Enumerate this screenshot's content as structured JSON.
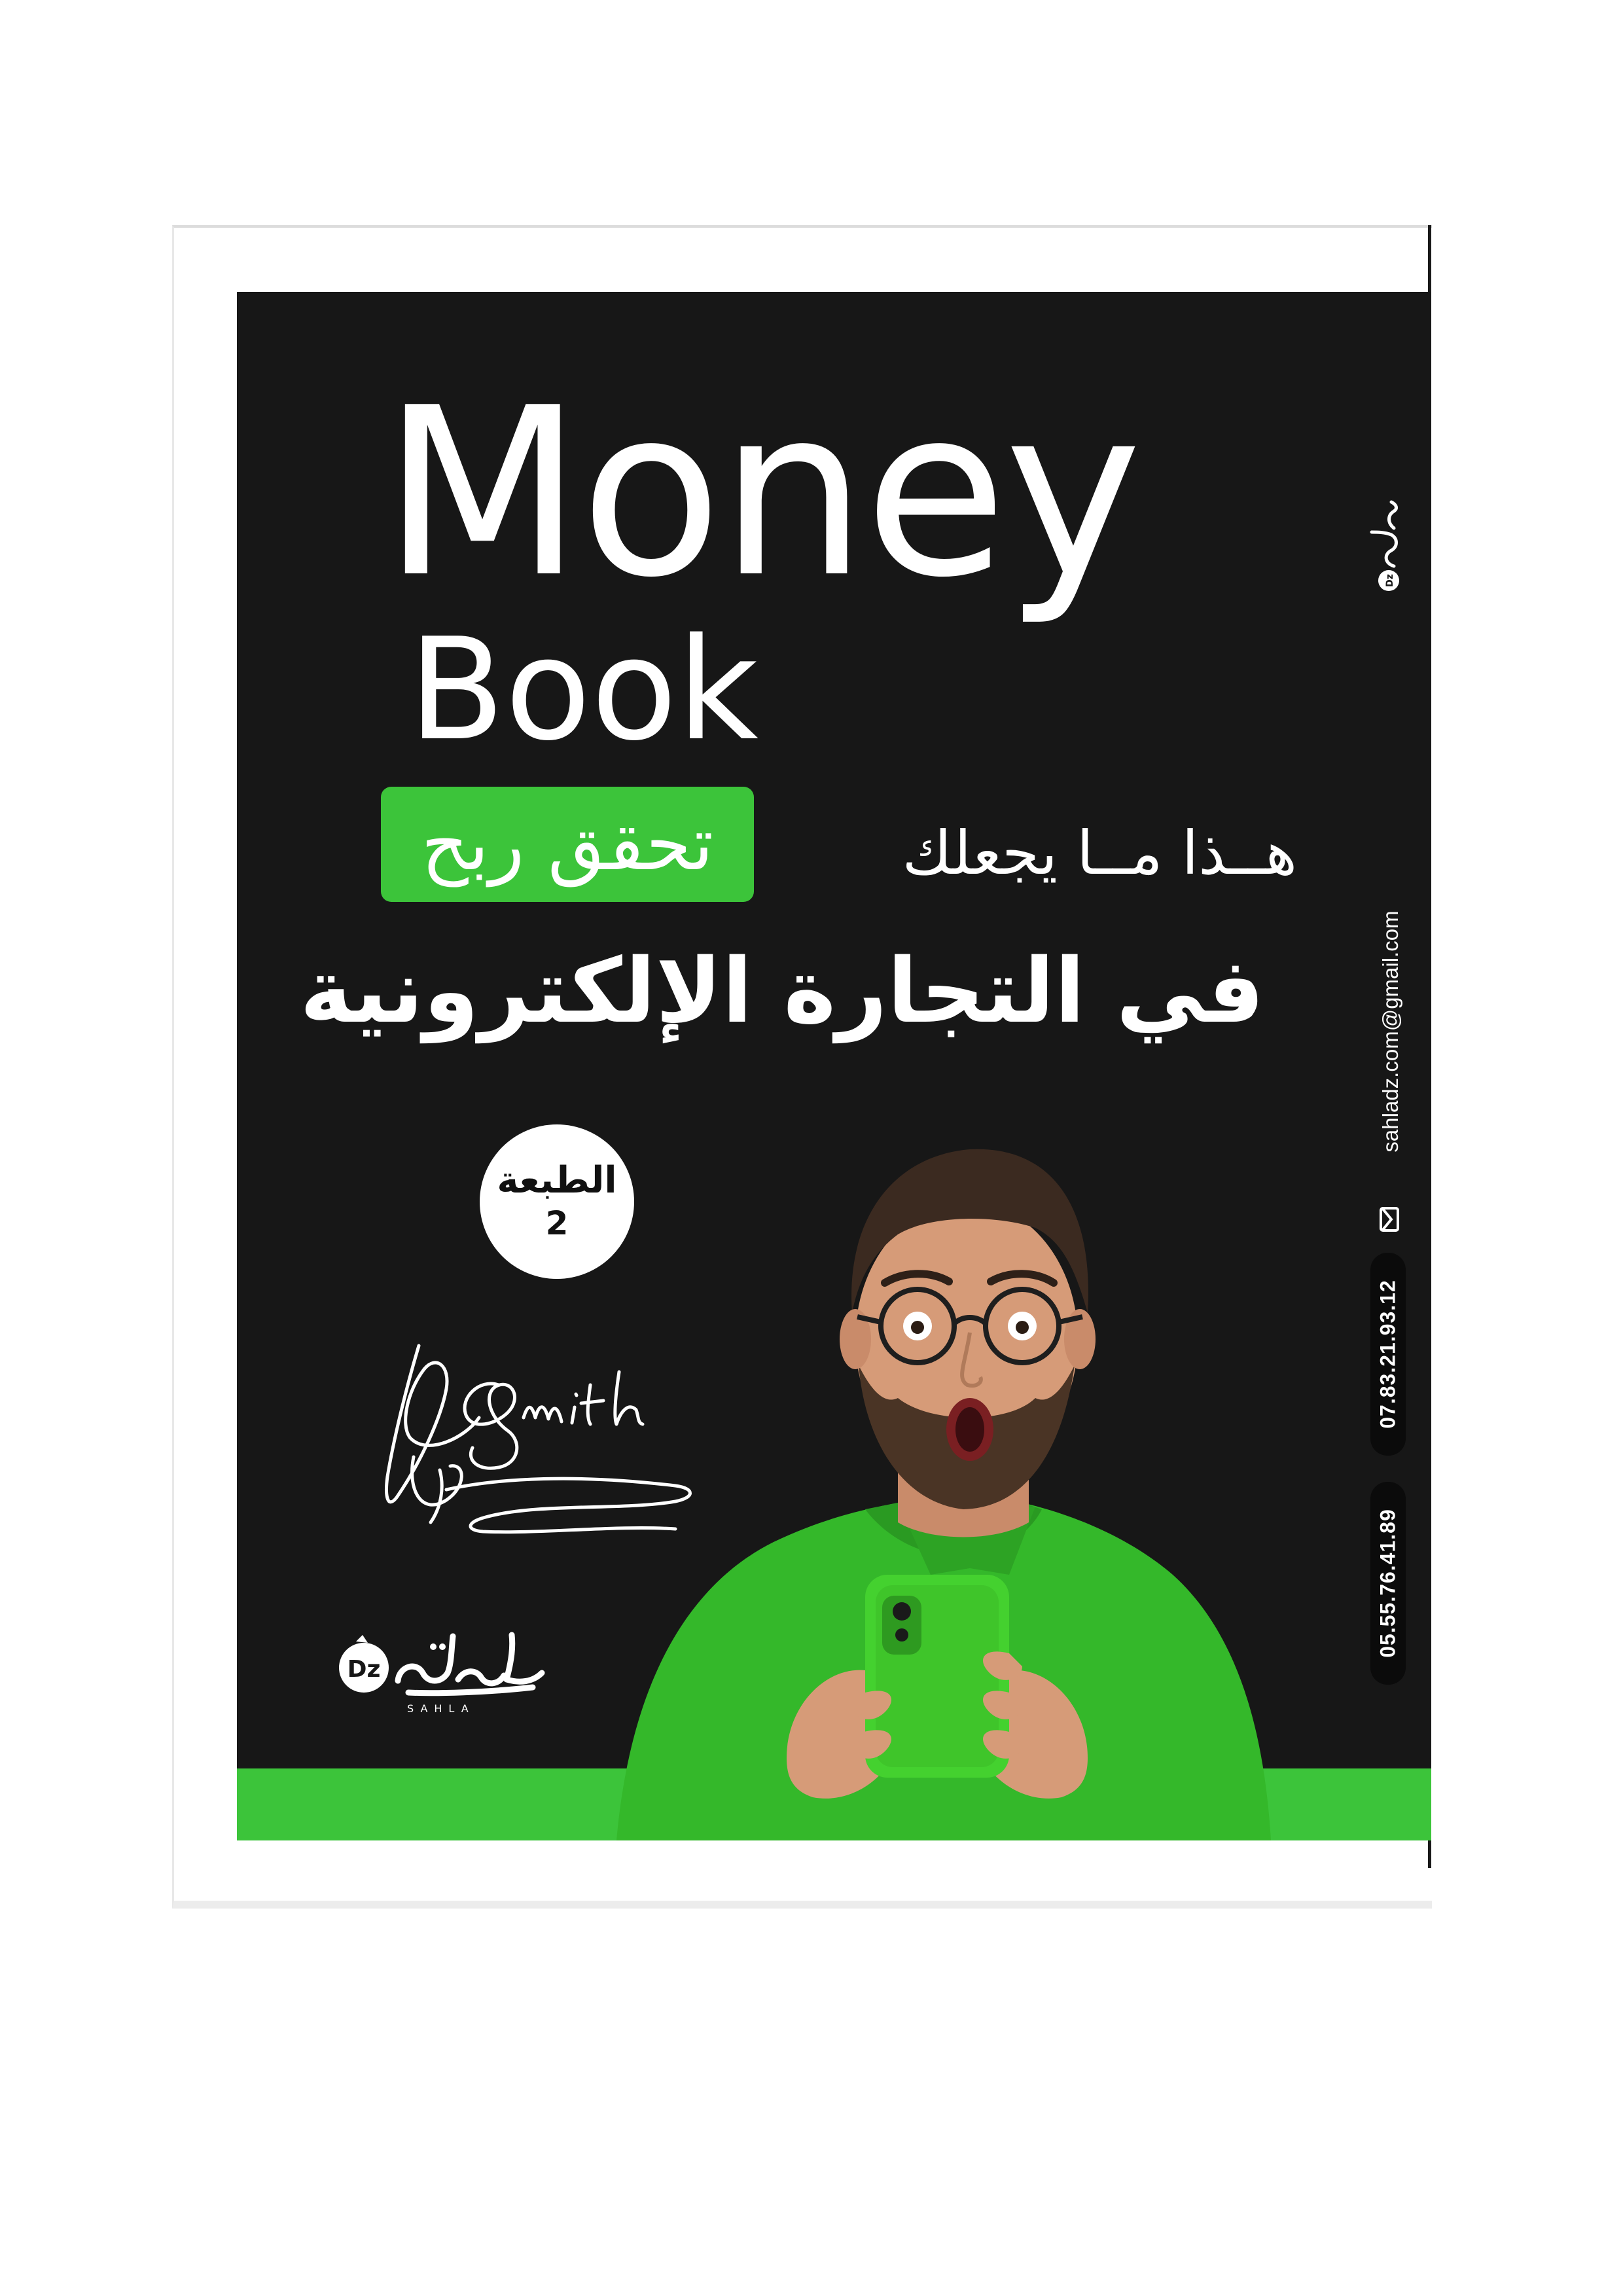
{
  "cover": {
    "title_line1": "Money",
    "title_line2": "Book",
    "tagline_prefix": "هــذا مــا يجعلك",
    "tagline_highlight": "تحقق ربح",
    "subtitle": "في التجارة الإلكترونية",
    "edition_label": "الطبعة",
    "edition_number": "2",
    "signature_text": "Smith"
  },
  "brand": {
    "logo_badge": "Dz",
    "logo_arabic": "سهلة",
    "logo_latin": "SAHLA"
  },
  "contact": {
    "email": "sahladz.com@gmail.com",
    "phone_1": "07.83.21.93.12",
    "phone_2": "05.55.76.41.89"
  },
  "colors": {
    "cover_background": "#171717",
    "accent_green": "#3cc43a",
    "text": "#ffffff"
  },
  "icons": [
    "mail-icon",
    "sahla-logo",
    "signature"
  ]
}
